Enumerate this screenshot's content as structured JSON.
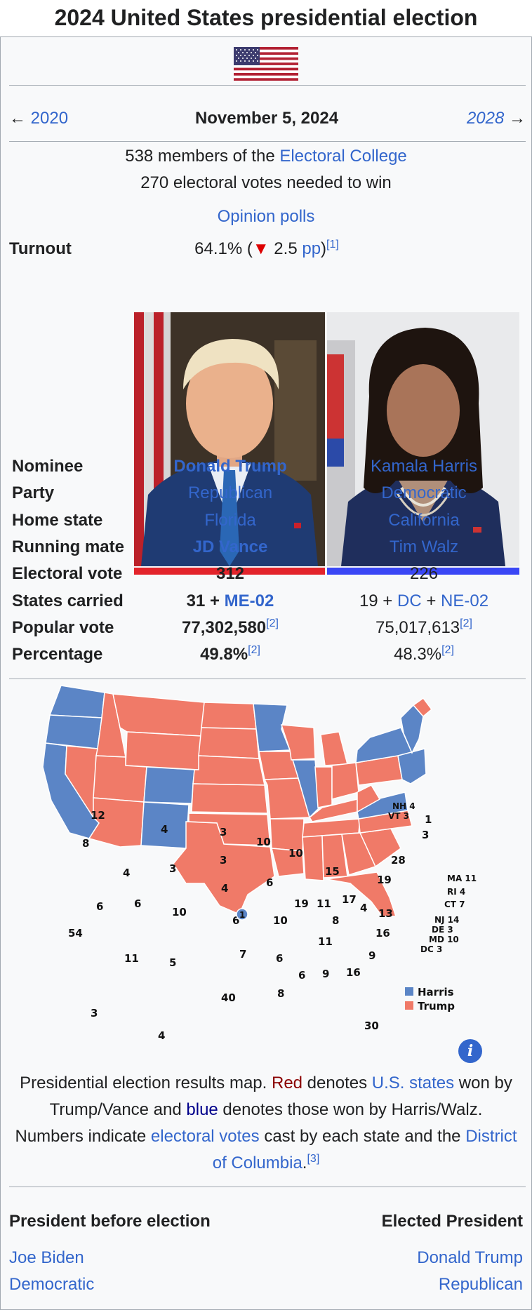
{
  "page_title": "2024 United States presidential election",
  "nav": {
    "prev_arrow": "←",
    "prev_label": "2020",
    "date": "November 5, 2024",
    "next_label": "2028",
    "next_arrow": "→"
  },
  "info": {
    "line1_prefix": "538 members of the ",
    "line1_link": "Electoral College",
    "line2": "270 electoral votes needed to win",
    "polls_link": "Opinion polls",
    "turnout_label": "Turnout",
    "turnout_value": "64.1% (",
    "turnout_down_icon": "▼",
    "turnout_change": " 2.5 ",
    "turnout_unit_link": "pp",
    "turnout_close": ")",
    "turnout_ref": "[1]"
  },
  "colors": {
    "republican": "#e3242b",
    "democrat": "#3a47f5",
    "map_red": "#f07a68",
    "map_blue": "#5b85c6",
    "link": "#3366cc"
  },
  "candidates": {
    "labels": {
      "nominee": "Nominee",
      "party": "Party",
      "home_state": "Home state",
      "running_mate": "Running mate",
      "electoral_vote": "Electoral vote",
      "states_carried": "States carried",
      "popular_vote": "Popular vote",
      "percentage": "Percentage"
    },
    "trump": {
      "nominee": "Donald Trump",
      "party": "Republican",
      "home_state": "Florida",
      "running_mate": "JD Vance",
      "electoral_vote": "312",
      "states_base": "31 + ",
      "states_link": "ME-02",
      "popular_vote": "77,302,580",
      "popular_ref": "[2]",
      "percentage": "49.8%",
      "percentage_ref": "[2]"
    },
    "harris": {
      "nominee": "Kamala Harris",
      "party": "Democratic",
      "home_state": "California",
      "running_mate": "Tim Walz",
      "electoral_vote": "226",
      "states_base": "19 + ",
      "states_link1": "DC",
      "states_plus": " + ",
      "states_link2": "NE-02",
      "popular_vote": "75,017,613",
      "popular_ref": "[2]",
      "percentage": "48.3%",
      "percentage_ref": "[2]"
    }
  },
  "map": {
    "legend_harris": "Harris",
    "legend_trump": "Trump",
    "info_icon": "i",
    "labels": {
      "wa": "12",
      "or": "8",
      "ca": "54",
      "nv": "6",
      "id": "4",
      "mt": "4",
      "wy": "3",
      "ut": "6",
      "az": "11",
      "co": "10",
      "nm": "5",
      "nd": "3",
      "sd": "3",
      "ne": "4",
      "ne2": "1",
      "ks": "6",
      "ok": "7",
      "tx": "40",
      "mn": "10",
      "ia": "6",
      "mo": "10",
      "ar": "6",
      "la": "8",
      "wi": "10",
      "il": "19",
      "mi": "15",
      "in": "11",
      "oh": "17",
      "ky": "8",
      "tn": "11",
      "ms": "6",
      "al": "9",
      "ga": "16",
      "fl": "30",
      "sc": "9",
      "nc": "16",
      "va": "13",
      "wv": "4",
      "pa": "19",
      "ny": "28",
      "me": "1",
      "me_dem": "3",
      "ak": "3",
      "hi": "4",
      "nh": "NH 4",
      "vt": "VT 3",
      "ma": "MA 11",
      "ri": "RI 4",
      "ct": "CT 7",
      "nj": "NJ 14",
      "de": "DE 3",
      "md": "MD 10",
      "dc": "DC 3"
    }
  },
  "caption": {
    "p1": "Presidential election results map. ",
    "red": "Red",
    "p2": " denotes ",
    "link1": "U.S. states",
    "p3": " won by Trump/Vance and ",
    "blue": "blue",
    "p4": " denotes those won by Harris/Walz. Numbers indicate ",
    "link2": "electoral votes",
    "p5": " cast by each state and the ",
    "link3": "District of Columbia",
    "p6": ".",
    "ref": "[3]"
  },
  "footer": {
    "before_label": "President before election",
    "elected_label": "Elected President",
    "before_name": "Joe Biden",
    "before_party": "Democratic",
    "elected_name": "Donald Trump",
    "elected_party": "Republican"
  }
}
